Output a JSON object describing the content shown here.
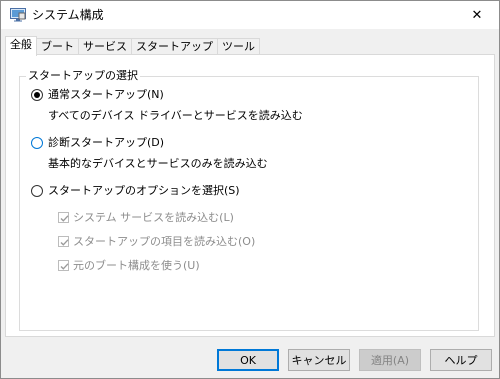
{
  "window": {
    "title": "システム構成",
    "icon": "system-config-icon",
    "close_glyph": "✕"
  },
  "tabs": [
    {
      "label": "全般",
      "active": true
    },
    {
      "label": "ブート",
      "active": false
    },
    {
      "label": "サービス",
      "active": false
    },
    {
      "label": "スタートアップ",
      "active": false
    },
    {
      "label": "ツール",
      "active": false
    }
  ],
  "startup_group": {
    "title": "スタートアップの選択",
    "normal": {
      "label": "通常スタートアップ(N)",
      "description": "すべてのデバイス ドライバーとサービスを読み込む",
      "selected": true
    },
    "diagnostic": {
      "label": "診断スタートアップ(D)",
      "description": "基本的なデバイスとサービスのみを読み込む",
      "selected": false
    },
    "selective": {
      "label": "スタートアップのオプションを選択(S)",
      "selected": false
    },
    "options": [
      {
        "label": "システム サービスを読み込む(L)",
        "checked": true,
        "enabled": false
      },
      {
        "label": "スタートアップの項目を読み込む(O)",
        "checked": true,
        "enabled": false
      },
      {
        "label": "元のブート構成を使う(U)",
        "checked": true,
        "enabled": false
      }
    ]
  },
  "buttons": {
    "ok": "OK",
    "cancel": "キャンセル",
    "apply": "適用(A)",
    "help": "ヘルプ"
  },
  "colors": {
    "accent": "#0078d7",
    "disabled_text": "#8d8d8d"
  }
}
